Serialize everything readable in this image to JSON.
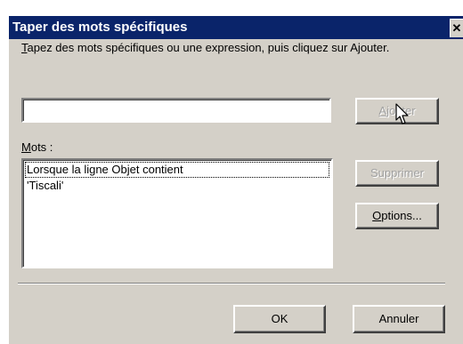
{
  "dialog": {
    "title": "Taper des mots spécifiques",
    "close_glyph": "✕",
    "instruction_underlined": "T",
    "instruction_rest": "apez des mots spécifiques ou une expression, puis cliquez sur Ajouter.",
    "input_value": "",
    "buttons": {
      "ajouter_underlined": "A",
      "ajouter_rest": "jouter",
      "supprimer": "Supprimer",
      "options_underlined": "O",
      "options_rest": "ptions...",
      "ok": "OK",
      "annuler": "Annuler"
    },
    "mots_label_underlined": "M",
    "mots_label_rest": "ots :",
    "words": [
      "Lorsque la ligne Objet contient",
      "'Tiscali'"
    ]
  },
  "icons": {
    "close": "close-icon",
    "cursor": "mouse-pointer-icon"
  }
}
